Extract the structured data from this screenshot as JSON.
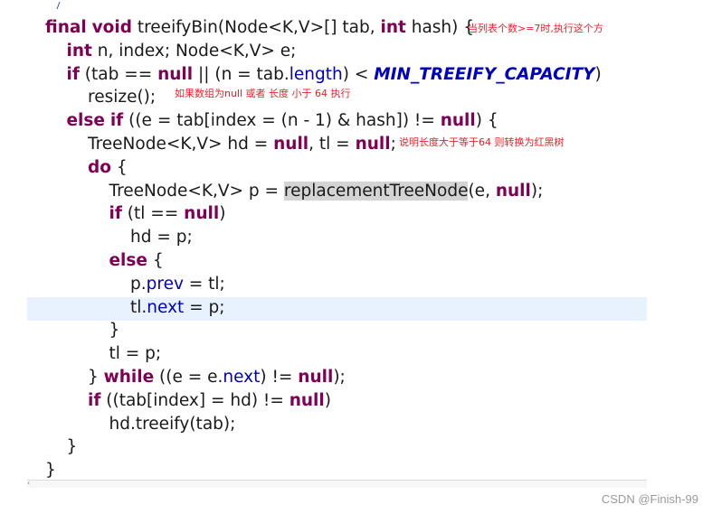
{
  "code": {
    "lines": [
      {
        "indent": 0,
        "tokens": [
          [
            "kw",
            "final"
          ],
          [
            "t",
            " "
          ],
          [
            "kw",
            "void"
          ],
          [
            "t",
            " treeifyBin(Node<K,V>[] tab, "
          ],
          [
            "kw",
            "int"
          ],
          [
            "t",
            " hash) {"
          ]
        ]
      },
      {
        "indent": 1,
        "tokens": [
          [
            "kw",
            "int"
          ],
          [
            "t",
            " n, index; Node<K,V> e;"
          ]
        ]
      },
      {
        "indent": 1,
        "tokens": [
          [
            "kw",
            "if"
          ],
          [
            "t",
            " (tab == "
          ],
          [
            "kw",
            "null"
          ],
          [
            "t",
            " || (n = tab."
          ],
          [
            "fld",
            "length"
          ],
          [
            "t",
            ") < "
          ],
          [
            "const",
            "MIN_TREEIFY_CAPACITY"
          ],
          [
            "t",
            ")"
          ]
        ]
      },
      {
        "indent": 2,
        "tokens": [
          [
            "t",
            "resize();"
          ]
        ]
      },
      {
        "indent": 1,
        "tokens": [
          [
            "kw",
            "else"
          ],
          [
            "t",
            " "
          ],
          [
            "kw",
            "if"
          ],
          [
            "t",
            " ((e = tab[index = (n - 1) & hash]) != "
          ],
          [
            "kw",
            "null"
          ],
          [
            "t",
            ") {"
          ]
        ]
      },
      {
        "indent": 2,
        "tokens": [
          [
            "t",
            "TreeNode<K,V> hd = "
          ],
          [
            "kw",
            "null"
          ],
          [
            "t",
            ", tl = "
          ],
          [
            "kw",
            "null"
          ],
          [
            "t",
            ";"
          ]
        ]
      },
      {
        "indent": 2,
        "tokens": [
          [
            "kw",
            "do"
          ],
          [
            "t",
            " {"
          ]
        ]
      },
      {
        "indent": 3,
        "tokens": [
          [
            "t",
            "TreeNode<K,V> p = "
          ],
          [
            "sel",
            "replacementTreeNode"
          ],
          [
            "t",
            "(e, "
          ],
          [
            "kw",
            "null"
          ],
          [
            "t",
            ");"
          ]
        ]
      },
      {
        "indent": 3,
        "tokens": [
          [
            "kw",
            "if"
          ],
          [
            "t",
            " (tl == "
          ],
          [
            "kw",
            "null"
          ],
          [
            "t",
            ")"
          ]
        ]
      },
      {
        "indent": 4,
        "tokens": [
          [
            "t",
            "hd = p;"
          ]
        ]
      },
      {
        "indent": 3,
        "tokens": [
          [
            "kw",
            "else"
          ],
          [
            "t",
            " {"
          ]
        ]
      },
      {
        "indent": 4,
        "tokens": [
          [
            "t",
            "p."
          ],
          [
            "fld",
            "prev"
          ],
          [
            "t",
            " = tl;"
          ]
        ]
      },
      {
        "indent": 4,
        "tokens": [
          [
            "t",
            "tl."
          ],
          [
            "fld",
            "next"
          ],
          [
            "t",
            " = p;"
          ]
        ]
      },
      {
        "indent": 3,
        "tokens": [
          [
            "t",
            "}"
          ]
        ]
      },
      {
        "indent": 3,
        "tokens": [
          [
            "t",
            "tl = p;"
          ]
        ]
      },
      {
        "indent": 2,
        "tokens": [
          [
            "t",
            "} "
          ],
          [
            "kw",
            "while"
          ],
          [
            "t",
            " ((e = e."
          ],
          [
            "fld",
            "next"
          ],
          [
            "t",
            ") != "
          ],
          [
            "kw",
            "null"
          ],
          [
            "t",
            ");"
          ]
        ]
      },
      {
        "indent": 2,
        "tokens": [
          [
            "kw",
            "if"
          ],
          [
            "t",
            " ((tab[index] = hd) != "
          ],
          [
            "kw",
            "null"
          ],
          [
            "t",
            ")"
          ]
        ]
      },
      {
        "indent": 3,
        "tokens": [
          [
            "t",
            "hd.treeify(tab);"
          ]
        ]
      },
      {
        "indent": 1,
        "tokens": [
          [
            "t",
            "}"
          ]
        ]
      },
      {
        "indent": 0,
        "tokens": [
          [
            "t",
            "}"
          ]
        ]
      }
    ],
    "highlighted_line": 12
  },
  "annotations": {
    "note1": "当列表个数>=7时,执行这个方",
    "note2": "如果数组为null 或者 长度 小于 64 执行",
    "note3": "说明长度大于等于64 则转换为红黑树"
  },
  "colors": {
    "keyword": "#7f0055",
    "field": "#0000c0",
    "annotation": "#e8222a",
    "current_line": "#e8f2fe",
    "selection": "#d4d4d4"
  },
  "watermark": "CSDN @Finish-99"
}
